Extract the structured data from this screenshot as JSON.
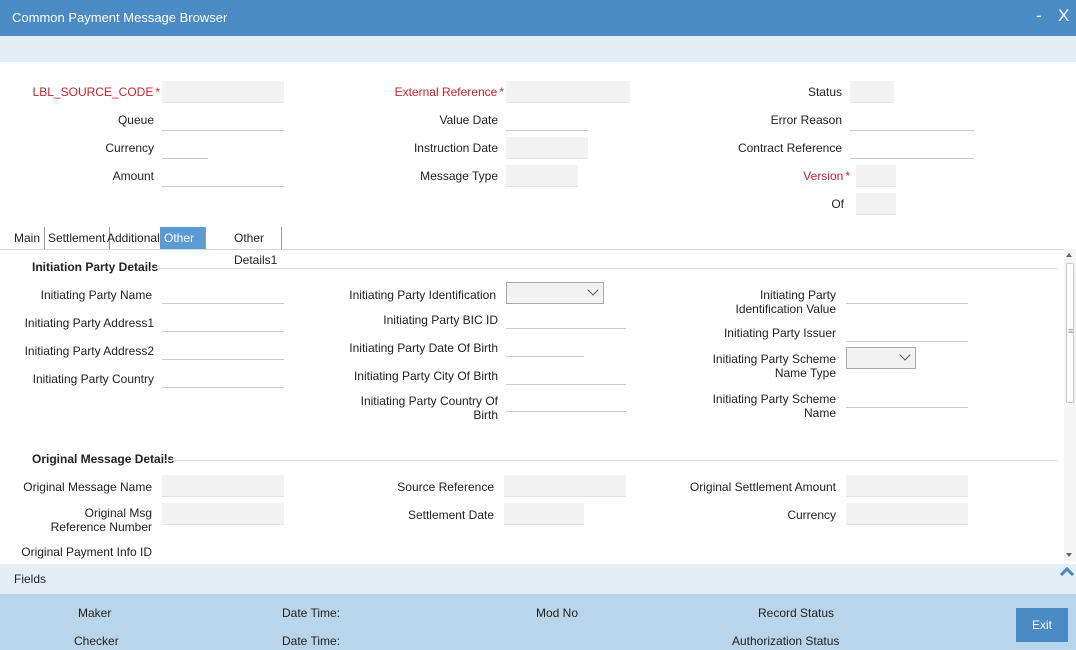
{
  "window": {
    "title": "Common Payment Message Browser",
    "minimize": "-",
    "close": "X"
  },
  "header": {
    "source_code_label": "LBL_SOURCE_CODE",
    "external_reference_label": "External Reference",
    "status_label": "Status",
    "queue_label": "Queue",
    "value_date_label": "Value Date",
    "error_reason_label": "Error Reason",
    "currency_label": "Currency",
    "instruction_date_label": "Instruction Date",
    "contract_reference_label": "Contract Reference",
    "amount_label": "Amount",
    "message_type_label": "Message Type",
    "version_label": "Version",
    "of_label": "Of",
    "required_mark": "*"
  },
  "tabs": [
    {
      "label": "Main"
    },
    {
      "label": "Settlement"
    },
    {
      "label": "Additional"
    },
    {
      "label": "Other Details"
    },
    {
      "label": "Other Details1"
    }
  ],
  "initiation": {
    "section_title": "Initiation Party Details",
    "party_name": "Initiating Party Name",
    "party_address1": "Initiating Party Address1",
    "party_address2": "Initiating Party Address2",
    "party_country": "Initiating Party Country",
    "party_identification": "Initiating Party Identification",
    "party_bic_id": "Initiating Party BIC ID",
    "party_dob": "Initiating Party Date Of Birth",
    "party_city_of_birth": "Initiating Party City Of Birth",
    "party_country_of_birth": "Initiating Party Country Of Birth",
    "party_identification_value": "Initiating Party Identification Value",
    "party_issuer": "Initiating Party Issuer",
    "party_scheme_name_type": "Initiating Party Scheme Name Type",
    "party_scheme_name": "Initiating Party Scheme Name"
  },
  "original": {
    "section_title": "Original Message Details",
    "message_name": "Original Message Name",
    "msg_reference_number": "Original Msg Reference Number",
    "payment_info_id": "Original Payment Info ID",
    "source_reference": "Source Reference",
    "settlement_date": "Settlement Date",
    "settlement_amount": "Original Settlement Amount",
    "currency": "Currency"
  },
  "fields_bar": {
    "label": "Fields"
  },
  "footer": {
    "maker": "Maker",
    "checker": "Checker",
    "date_time_1": "Date Time:",
    "date_time_2": "Date Time:",
    "mod_no": "Mod No",
    "record_status": "Record Status",
    "authorization_status": "Authorization Status",
    "exit_label": "Exit"
  }
}
